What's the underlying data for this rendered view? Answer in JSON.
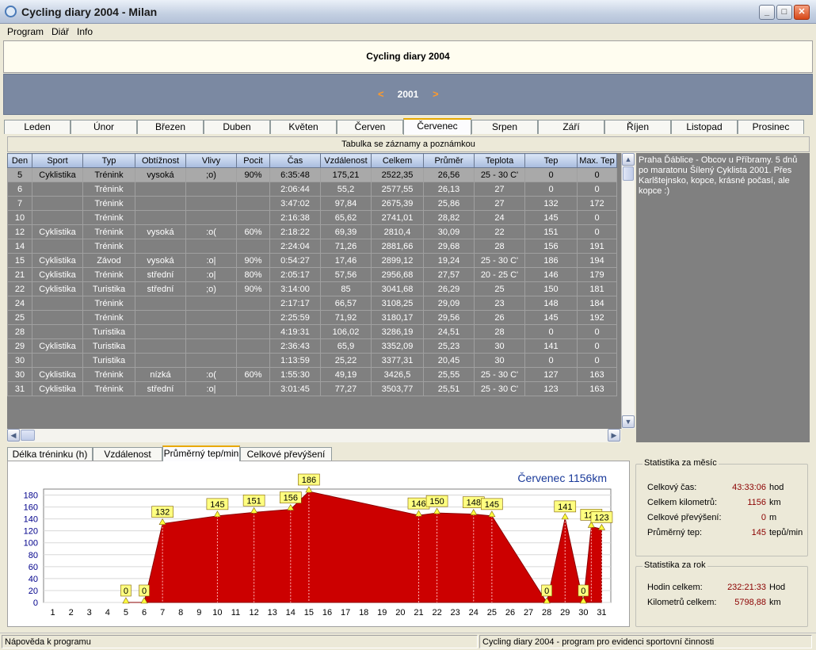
{
  "window": {
    "title": "Cycling diary 2004 - Milan"
  },
  "menu": [
    "Program",
    "Diář",
    "Info"
  ],
  "header": {
    "title": "Cycling diary 2004"
  },
  "year": {
    "value": "2001",
    "prev": "<",
    "next": ">"
  },
  "months": [
    "Leden",
    "Únor",
    "Březen",
    "Duben",
    "Květen",
    "Červen",
    "Červenec",
    "Srpen",
    "Září",
    "Říjen",
    "Listopad",
    "Prosinec"
  ],
  "active_month": 6,
  "table": {
    "caption": "Tabulka se záznamy a poznámkou",
    "columns": [
      "Den",
      "Sport",
      "Typ",
      "Obtížnost",
      "Vlivy",
      "Pocit",
      "Čas",
      "Vzdálenost",
      "Celkem",
      "Průměr",
      "Teplota",
      "Tep",
      "Max. Tep"
    ],
    "rows": [
      [
        "5",
        "Cyklistika",
        "Trénink",
        "vysoká",
        ";o)",
        "90%",
        "6:35:48",
        "175,21",
        "2522,35",
        "26,56",
        "25 - 30 C'",
        "0",
        "0"
      ],
      [
        "6",
        "",
        "Trénink",
        "",
        "",
        "",
        "2:06:44",
        "55,2",
        "2577,55",
        "26,13",
        "27",
        "0",
        "0"
      ],
      [
        "7",
        "",
        "Trénink",
        "",
        "",
        "",
        "3:47:02",
        "97,84",
        "2675,39",
        "25,86",
        "27",
        "132",
        "172"
      ],
      [
        "10",
        "",
        "Trénink",
        "",
        "",
        "",
        "2:16:38",
        "65,62",
        "2741,01",
        "28,82",
        "24",
        "145",
        "0"
      ],
      [
        "12",
        "Cyklistika",
        "Trénink",
        "vysoká",
        ":o(",
        "60%",
        "2:18:22",
        "69,39",
        "2810,4",
        "30,09",
        "22",
        "151",
        "0"
      ],
      [
        "14",
        "",
        "Trénink",
        "",
        "",
        "",
        "2:24:04",
        "71,26",
        "2881,66",
        "29,68",
        "28",
        "156",
        "191"
      ],
      [
        "15",
        "Cyklistika",
        "Závod",
        "vysoká",
        ":o|",
        "90%",
        "0:54:27",
        "17,46",
        "2899,12",
        "19,24",
        "25 - 30 C'",
        "186",
        "194"
      ],
      [
        "21",
        "Cyklistika",
        "Trénink",
        "střední",
        ":o|",
        "80%",
        "2:05:17",
        "57,56",
        "2956,68",
        "27,57",
        "20 - 25 C'",
        "146",
        "179"
      ],
      [
        "22",
        "Cyklistika",
        "Turistika",
        "střední",
        ";o)",
        "90%",
        "3:14:00",
        "85",
        "3041,68",
        "26,29",
        "25",
        "150",
        "181"
      ],
      [
        "24",
        "",
        "Trénink",
        "",
        "",
        "",
        "2:17:17",
        "66,57",
        "3108,25",
        "29,09",
        "23",
        "148",
        "184"
      ],
      [
        "25",
        "",
        "Trénink",
        "",
        "",
        "",
        "2:25:59",
        "71,92",
        "3180,17",
        "29,56",
        "26",
        "145",
        "192"
      ],
      [
        "28",
        "",
        "Turistika",
        "",
        "",
        "",
        "4:19:31",
        "106,02",
        "3286,19",
        "24,51",
        "28",
        "0",
        "0"
      ],
      [
        "29",
        "Cyklistika",
        "Turistika",
        "",
        "",
        "",
        "2:36:43",
        "65,9",
        "3352,09",
        "25,23",
        "30",
        "141",
        "0"
      ],
      [
        "30",
        "",
        "Turistika",
        "",
        "",
        "",
        "1:13:59",
        "25,22",
        "3377,31",
        "20,45",
        "30",
        "0",
        "0"
      ],
      [
        "30",
        "Cyklistika",
        "Trénink",
        "nízká",
        ":o(",
        "60%",
        "1:55:30",
        "49,19",
        "3426,5",
        "25,55",
        "25 - 30 C'",
        "127",
        "163"
      ],
      [
        "31",
        "Cyklistika",
        "Trénink",
        "střední",
        ":o|",
        "",
        "3:01:45",
        "77,27",
        "3503,77",
        "25,51",
        "25 - 30 C'",
        "123",
        "163"
      ]
    ]
  },
  "note": "Praha Ďáblice - Obcov u Příbramy. 5 dnů po maratonu Šílený Cyklista 2001. Přes Karlštejnsko, kopce, krásné počasí, ale kopce :)",
  "chart_tabs": [
    "Délka tréninku (h) %",
    "Vzdálenost (km)",
    "Průměrný tep/min",
    "Celkové převýšení (m)"
  ],
  "active_chart_tab": 2,
  "chart_data": {
    "type": "area",
    "title": "Červenec 1156km",
    "x": [
      5,
      6,
      7,
      10,
      12,
      14,
      15,
      21,
      22,
      24,
      25,
      28,
      29,
      30,
      30,
      31
    ],
    "values": [
      0,
      0,
      132,
      145,
      151,
      156,
      186,
      146,
      150,
      148,
      145,
      0,
      141,
      0,
      127,
      123
    ],
    "xticks": [
      1,
      2,
      3,
      4,
      5,
      6,
      7,
      8,
      9,
      10,
      11,
      12,
      13,
      14,
      15,
      16,
      17,
      18,
      19,
      20,
      21,
      22,
      23,
      24,
      25,
      26,
      27,
      28,
      29,
      30,
      31
    ],
    "yticks": [
      0,
      20,
      40,
      60,
      80,
      100,
      120,
      140,
      160,
      180
    ],
    "xlim": [
      0.5,
      31.5
    ],
    "ylim": [
      0,
      190
    ],
    "color": "#cc0000"
  },
  "stats_month": {
    "caption": "Statistika za měsíc",
    "rows": [
      {
        "label": "Celkový čas:",
        "value": "43:33:06",
        "unit": "hod"
      },
      {
        "label": "Celkem kilometrů:",
        "value": "1156",
        "unit": "km"
      },
      {
        "label": "Celkové převýšení:",
        "value": "0",
        "unit": "m"
      },
      {
        "label": "Průměrný tep:",
        "value": "145",
        "unit": "tepů/min"
      }
    ]
  },
  "stats_year": {
    "caption": "Statistika za rok",
    "rows": [
      {
        "label": "Hodin celkem:",
        "value": "232:21:33",
        "unit": "Hod"
      },
      {
        "label": "Kilometrů celkem:",
        "value": "5798,88",
        "unit": "km"
      }
    ]
  },
  "status": {
    "left": "Nápověda k programu",
    "right": "Cycling diary 2004 - program pro evidenci sportovní činnosti"
  }
}
